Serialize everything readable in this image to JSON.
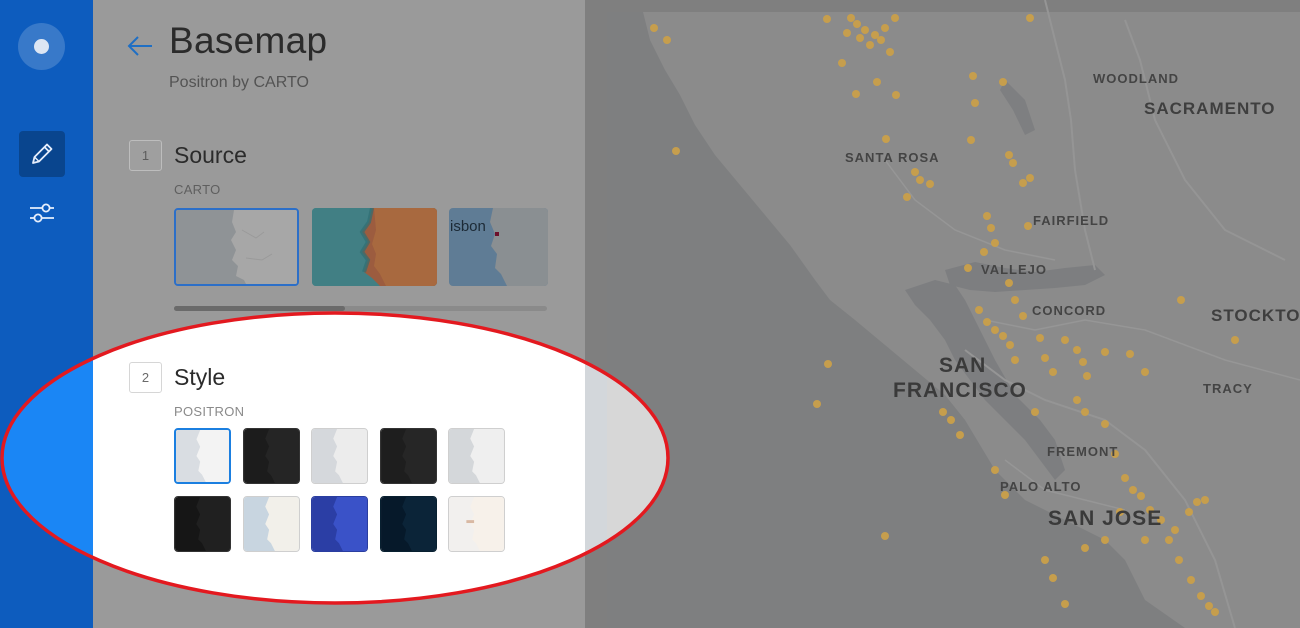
{
  "panel": {
    "title": "Basemap",
    "subtitle": "Positron by CARTO",
    "steps": [
      {
        "number": "1",
        "label": "Source",
        "sublabel": "CARTO"
      },
      {
        "number": "2",
        "label": "Style",
        "sublabel": "POSITRON"
      }
    ],
    "source_thumb_text": "isbon"
  },
  "map": {
    "cities": [
      {
        "name": "WOODLAND"
      },
      {
        "name": "SACRAMENTO"
      },
      {
        "name": "SANTA ROSA"
      },
      {
        "name": "FAIRFIELD"
      },
      {
        "name": "VALLEJO"
      },
      {
        "name": "CONCORD"
      },
      {
        "name": "STOCKTON"
      },
      {
        "name": "SAN"
      },
      {
        "name": "FRANCISCO"
      },
      {
        "name": "TRACY"
      },
      {
        "name": "FREMONT"
      },
      {
        "name": "PALO ALTO"
      },
      {
        "name": "SAN JOSE"
      }
    ],
    "point_color": "#e3a81f"
  },
  "colors": {
    "rail": "#0d5cbe",
    "accent": "#1b7fe0",
    "annotation": "#e3191f"
  },
  "icons": {
    "back": "arrow-left-icon",
    "edit": "pencil-icon",
    "filters": "sliders-icon"
  }
}
